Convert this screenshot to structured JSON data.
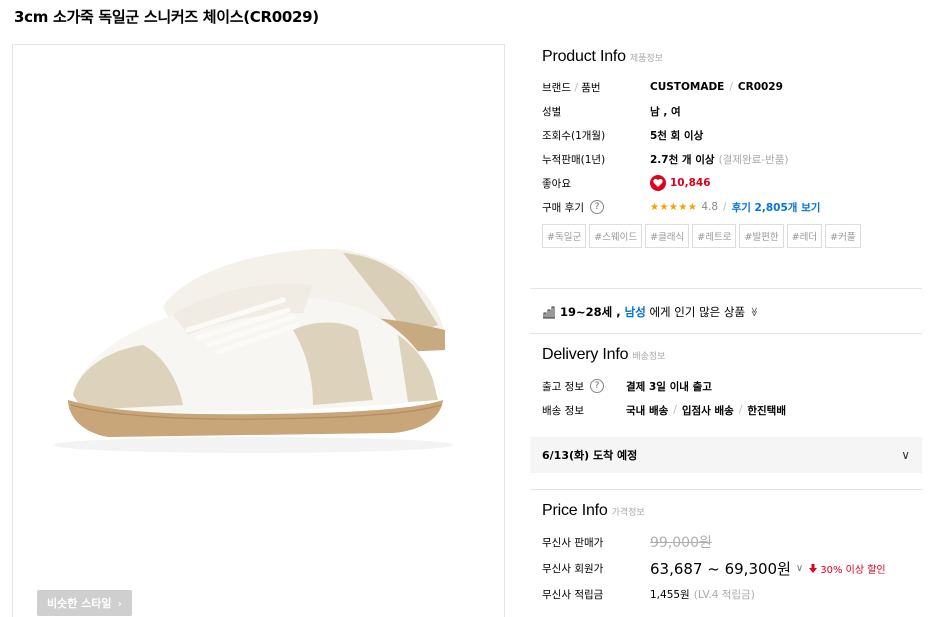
{
  "product": {
    "title": "3cm 소가죽 독일군 스니커즈 체이스(CR0029)",
    "similar_style_label": "비슷한 스타일",
    "similar_style_chevron": "›"
  },
  "product_info": {
    "title": "Product Info",
    "subtitle": "제품정보",
    "brand_label": "브랜드 / 품번",
    "brand_label_a": "브랜드",
    "brand_label_b": "품번",
    "brand_value": "CUSTOMADE",
    "product_code": "CR0029",
    "gender_label": "성별",
    "gender_value": "남 , 여",
    "views_label": "조회수(1개월)",
    "views_value": "5천 회 이상",
    "sales_label": "누적판매(1년)",
    "sales_value": "2.7천 개 이상",
    "sales_note": "(결제완료-반품)",
    "likes_label": "좋아요",
    "likes_value": "10,846",
    "review_label": "구매 후기",
    "review_help": "?",
    "review_stars": "★★★★★",
    "review_score": "4.8",
    "review_link": "후기 2,805개 보기",
    "tags": [
      "#독일군",
      "#스웨이드",
      "#클래식",
      "#레트로",
      "#발편한",
      "#레더",
      "#커플"
    ]
  },
  "popular": {
    "prefix": "19~28세 , ",
    "age": "19~28세",
    "gender": "남성",
    "suffix": "에게 인기 많은 상품",
    "chevron": "≫"
  },
  "delivery_info": {
    "title": "Delivery Info",
    "subtitle": "배송정보",
    "ship_label": "출고 정보",
    "ship_help": "?",
    "ship_value": "결제 3일 이내 출고",
    "delivery_label": "배송 정보",
    "delivery_a": "국내 배송",
    "delivery_b": "입점사 배송",
    "delivery_c": "한진택배",
    "arrival": "6/13(화) 도착 예정",
    "arrival_chevron": "∨"
  },
  "price_info": {
    "title": "Price Info",
    "subtitle": "가격정보",
    "sale_label": "무신사 판매가",
    "sale_value": "99,000원",
    "member_label": "무신사 회원가",
    "member_value": "63,687 ~ 69,300원",
    "member_chevron": "∨",
    "discount": "30% 이상 할인",
    "points_label": "무신사 적립금",
    "points_value": "1,455원",
    "points_note": "(LV.4 적립금)"
  },
  "colors": {
    "accent_red": "#e0001a",
    "link_blue": "#0074d9",
    "star": "#f4a100"
  }
}
